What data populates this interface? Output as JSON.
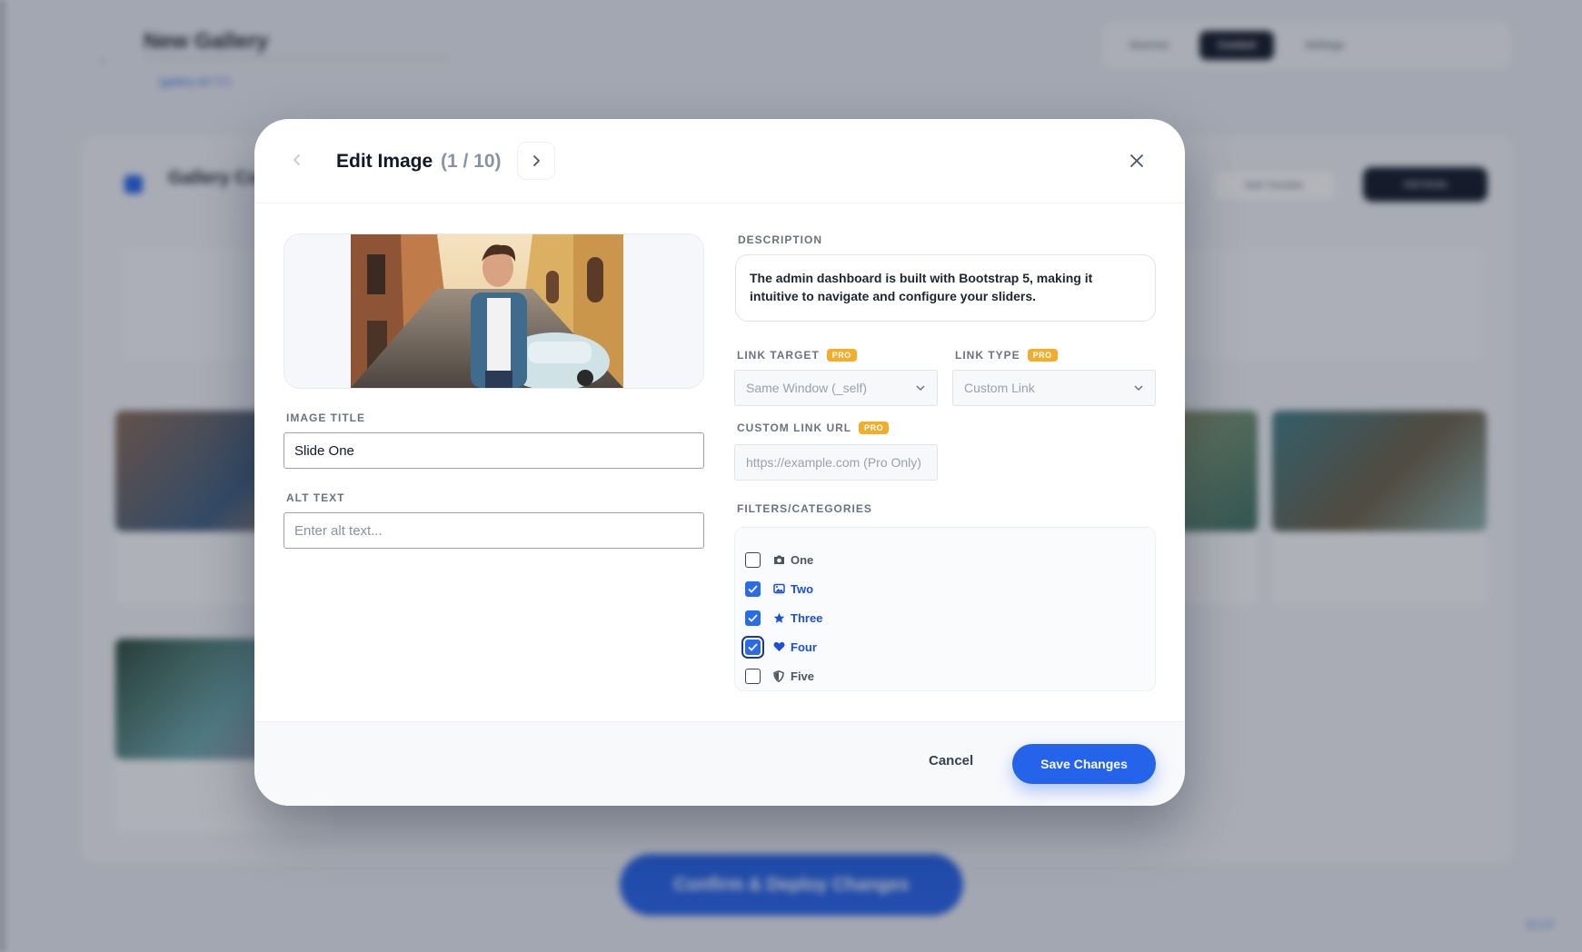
{
  "background": {
    "page_title": "New Gallery",
    "shortcode": "[gallery id=\"1\"]",
    "tabs": [
      "Sources",
      "Content",
      "Settings"
    ],
    "panel_title": "Gallery Content",
    "bulk_button": "Bulk Translate",
    "add_button": "Add Media",
    "deploy_button": "Confirm & Deploy Changes",
    "version": "v2.1.0"
  },
  "modal": {
    "title": "Edit Image",
    "counter": "(1 / 10)",
    "image_title_label": "IMAGE TITLE",
    "image_title_value": "Slide One",
    "alt_text_label": "ALT TEXT",
    "alt_text_placeholder": "Enter alt text...",
    "description_label": "DESCRIPTION",
    "description": "The admin dashboard is built with Bootstrap 5, making it intuitive to navigate and configure your sliders.",
    "link_target_label": "LINK TARGET",
    "link_target_value": "Same Window (_self)",
    "link_type_label": "LINK TYPE",
    "link_type_value": "Custom Link",
    "custom_url_label": "CUSTOM LINK URL",
    "custom_url_placeholder": "https://example.com (Pro Only)",
    "pro_badge": "PRO",
    "filters_label": "FILTERS/CATEGORIES",
    "filters": [
      {
        "label": "One",
        "icon": "camera-icon",
        "checked": false
      },
      {
        "label": "Two",
        "icon": "image-icon",
        "checked": true
      },
      {
        "label": "Three",
        "icon": "star-icon",
        "checked": true
      },
      {
        "label": "Four",
        "icon": "heart-icon",
        "checked": true
      },
      {
        "label": "Five",
        "icon": "shield-icon",
        "checked": false
      }
    ],
    "cancel_label": "Cancel",
    "save_label": "Save Changes"
  },
  "colors": {
    "accent": "#2563eb",
    "pro_badge": "#f0ad2e",
    "overlay": "#1c2334"
  }
}
